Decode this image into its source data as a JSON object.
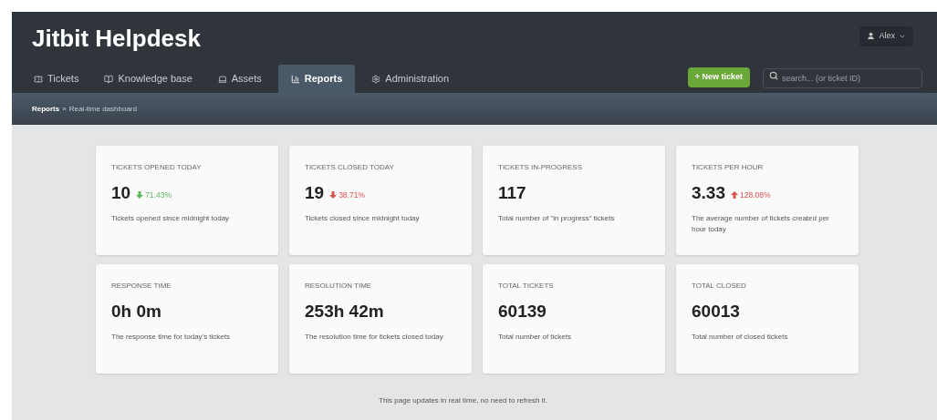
{
  "header": {
    "title": "Jitbit Helpdesk",
    "user": "Alex"
  },
  "tabs": [
    {
      "label": "Tickets",
      "kind": "ticket",
      "selected": false
    },
    {
      "label": "Knowledge base",
      "kind": "book",
      "selected": false
    },
    {
      "label": "Assets",
      "kind": "laptop",
      "selected": false
    },
    {
      "label": "Reports",
      "kind": "chart",
      "selected": true
    },
    {
      "label": "Administration",
      "kind": "gear",
      "selected": false
    }
  ],
  "new_ticket_button": "+ New ticket",
  "search": {
    "placeholder": "search... (or ticket ID)"
  },
  "breadcrumb": {
    "parent": "Reports",
    "separator": "»",
    "current": "Real-time dashboard"
  },
  "cards": [
    {
      "title": "TICKETS OPENED TODAY",
      "value": "10",
      "trend": {
        "kind": "down",
        "text": "71.43%",
        "color": "#5cb85c"
      },
      "description": "Tickets opened since midnight today"
    },
    {
      "title": "TICKETS CLOSED TODAY",
      "value": "19",
      "trend": {
        "kind": "down",
        "text": "38.71%",
        "color": "#d9534f"
      },
      "description": "Tickets closed since midnight today"
    },
    {
      "title": "TICKETS IN-PROGRESS",
      "value": "117",
      "description": "Total number of \"in progress\" tickets"
    },
    {
      "title": "TICKETS PER HOUR",
      "value": "3.33",
      "trend": {
        "kind": "up",
        "text": "128.08%",
        "color": "#d9534f"
      },
      "description": "The average number of tickets created per hour today"
    },
    {
      "title": "RESPONSE TIME",
      "value": "0h 0m",
      "description": "The response time for today's tickets"
    },
    {
      "title": "RESOLUTION TIME",
      "value": "253h 42m",
      "description": "The resolution time for tickets closed today"
    },
    {
      "title": "TOTAL TICKETS",
      "value": "60139",
      "description": "Total number of tickets"
    },
    {
      "title": "TOTAL CLOSED",
      "value": "60013",
      "description": "Total number of closed tickets"
    }
  ],
  "footer_note": "This page updates in real time, no need to refresh it."
}
